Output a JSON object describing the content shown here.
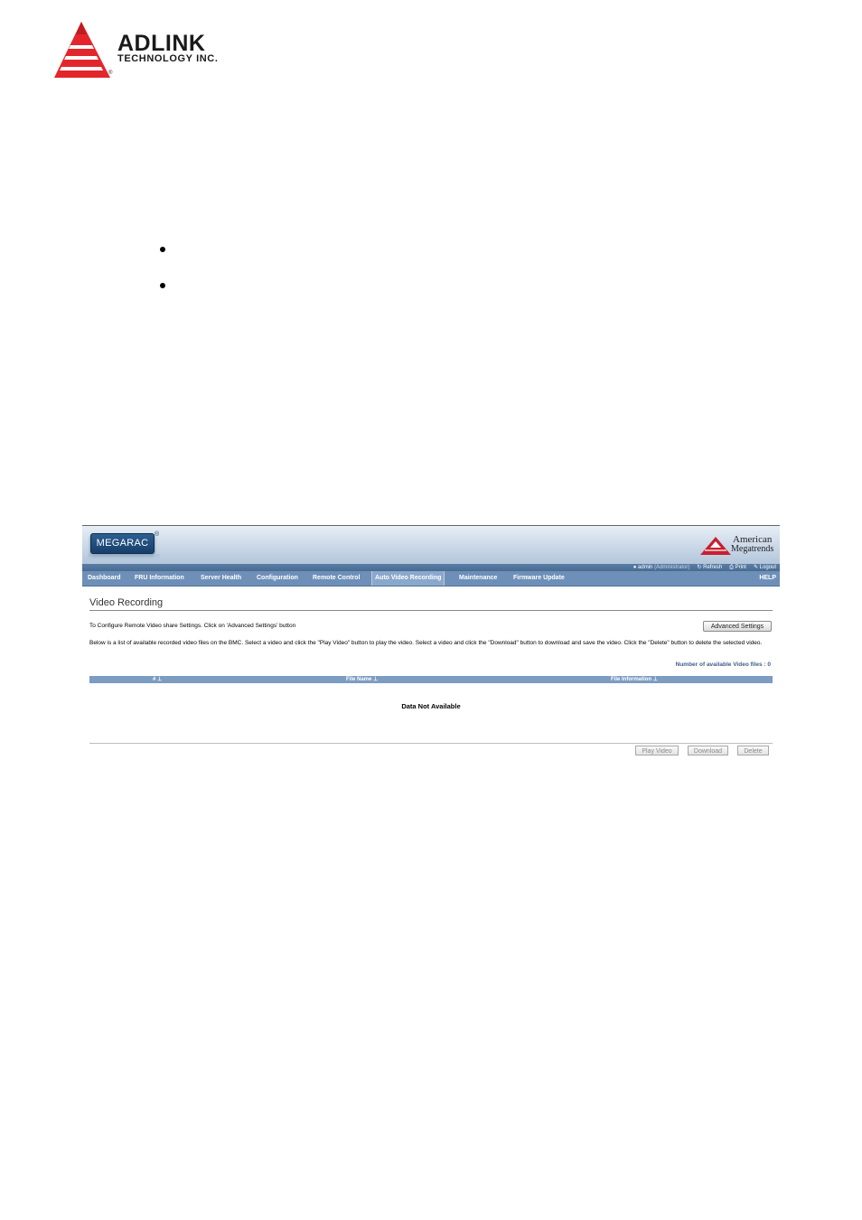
{
  "header_logo": {
    "name": "ADLINK",
    "sub": "TECHNOLOGY INC.",
    "registered": "®",
    "accent": "#e3262b"
  },
  "screenshot": {
    "brand": "MEGARAC",
    "brand_reg": "®",
    "vendor_line1": "American",
    "vendor_line2": "Megatrends",
    "userbar": {
      "user": "admin",
      "role": "(Administrator)",
      "refresh": "Refresh",
      "print": "Print",
      "logout": "Logout"
    },
    "nav": [
      {
        "label": "Dashboard"
      },
      {
        "label": "FRU Information"
      },
      {
        "label": "Server Health"
      },
      {
        "label": "Configuration"
      },
      {
        "label": "Remote Control"
      },
      {
        "label": "Auto Video Recording",
        "active": true
      },
      {
        "label": "Maintenance"
      },
      {
        "label": "Firmware Update"
      }
    ],
    "help": "HELP",
    "page_title": "Video Recording",
    "desc1": "To Configure Remote Video share Settings. Click on 'Advanced Settings' button",
    "advanced_settings": "Advanced Settings",
    "desc2": "Below is a list of available recorded video files on the BMC. Select a video and click the \"Play Video\" button to play the video. Select a video and click the \"Download\" button to download and save the video. Click the \"Delete\" button to delete the selected video.",
    "count_label": "Number of available Video files : 0",
    "table": {
      "columns": [
        "#",
        "File Name",
        "File Information"
      ],
      "empty": "Data Not Available"
    },
    "buttons": {
      "play": "Play Video",
      "download": "Download",
      "delete": "Delete"
    },
    "colors": {
      "nav_bg": "#6e90b8",
      "header_bg": "#7c9cc2",
      "brand_blue": "#183f6a",
      "ami_red": "#c8202f"
    }
  }
}
